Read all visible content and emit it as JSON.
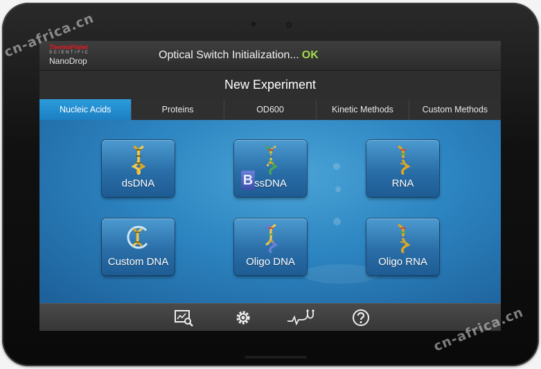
{
  "brand": {
    "company": "ThermoFisher",
    "division": "SCIENTIFIC",
    "product": "NanoDrop"
  },
  "status": {
    "message": "Optical Switch Initialization...",
    "ok_text": "OK"
  },
  "header": {
    "title": "New Experiment"
  },
  "tabs": [
    {
      "label": "Nucleic Acids",
      "active": true
    },
    {
      "label": "Proteins",
      "active": false
    },
    {
      "label": "OD600",
      "active": false
    },
    {
      "label": "Kinetic Methods",
      "active": false
    },
    {
      "label": "Custom Methods",
      "active": false
    }
  ],
  "tiles": [
    {
      "label": "dsDNA",
      "icon": "dna-helix-icon"
    },
    {
      "label": "ssDNA",
      "icon": "dna-helix-icon"
    },
    {
      "label": "RNA",
      "icon": "dna-helix-icon"
    },
    {
      "label": "Custom DNA",
      "icon": "custom-dna-icon"
    },
    {
      "label": "Oligo DNA",
      "icon": "dna-helix-icon"
    },
    {
      "label": "Oligo RNA",
      "icon": "dna-helix-icon"
    }
  ],
  "toolbar": [
    {
      "icon": "data-viewer-icon"
    },
    {
      "icon": "settings-gear-icon"
    },
    {
      "icon": "diagnostics-stethoscope-icon"
    },
    {
      "icon": "help-icon"
    }
  ],
  "watermark": {
    "text": "cn-africa.cn"
  },
  "colors": {
    "accent_tab": "#1c7fc2",
    "ok_green": "#a6d84c",
    "brand_red": "#e21b23",
    "tile_blue": "#2a6ea8"
  }
}
